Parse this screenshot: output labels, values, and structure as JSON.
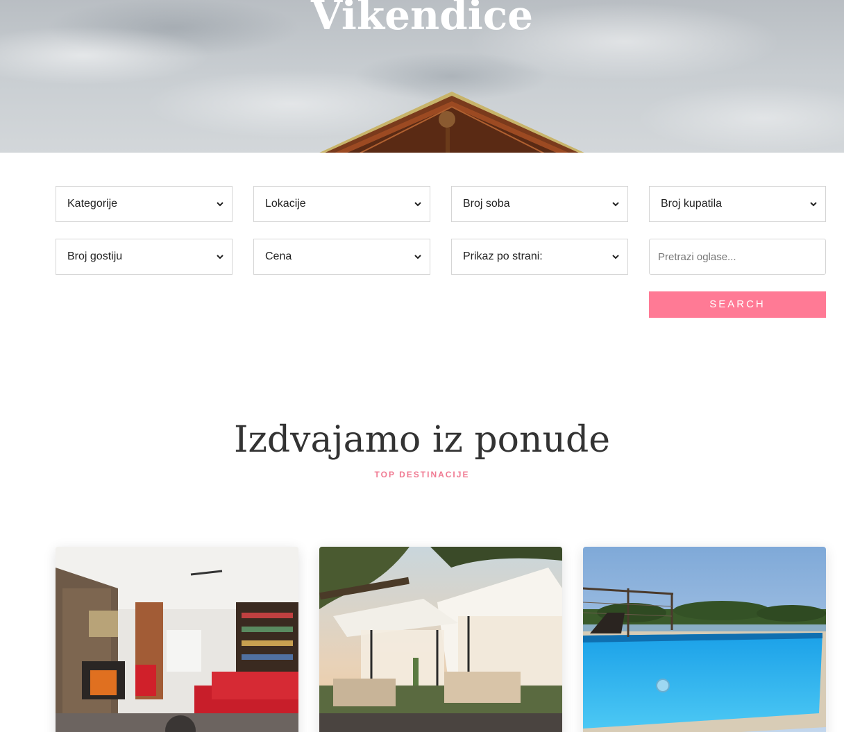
{
  "hero": {
    "title": "Vikendice"
  },
  "filters": {
    "kategorije": "Kategorije",
    "lokacije": "Lokacije",
    "broj_soba": "Broj soba",
    "broj_kupatila": "Broj kupatila",
    "broj_gostiju": "Broj gostiju",
    "cena": "Cena",
    "prikaz_po_strani": "Prikaz po strani:",
    "search_placeholder": "Pretrazi oglase...",
    "search_button": "SEARCH",
    "chevron_icon": "chevron-down-icon"
  },
  "section": {
    "title": "Izdvajamo iz ponude",
    "subtitle": "TOP DESTINACIJE"
  },
  "colors": {
    "accent": "#ff7a95",
    "subtitle": "#f07a92",
    "heading": "#333333"
  },
  "cards": [
    {
      "image": "living-room-fireplace"
    },
    {
      "image": "garden-gazebo-sunset"
    },
    {
      "image": "swimming-pool-river"
    }
  ]
}
